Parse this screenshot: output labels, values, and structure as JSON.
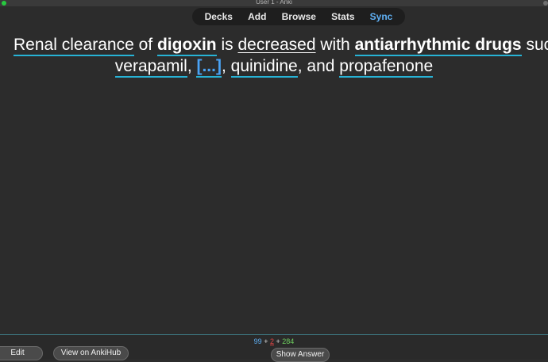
{
  "window": {
    "title": "User 1 - Anki"
  },
  "toolbar": {
    "items": [
      {
        "label": "Decks"
      },
      {
        "label": "Add"
      },
      {
        "label": "Browse"
      },
      {
        "label": "Stats"
      },
      {
        "label": "Sync",
        "active_color": "#5fb0f5"
      }
    ]
  },
  "card": {
    "line1": [
      {
        "text": "Renal clearance",
        "style": "highlight"
      },
      {
        "text": " of "
      },
      {
        "text": "digoxin",
        "style": "bold-highlight"
      },
      {
        "text": " is "
      },
      {
        "text": "decreased",
        "style": "underline"
      },
      {
        "text": " with "
      },
      {
        "text": "antiarrhythmic drugs",
        "style": "bold-highlight"
      },
      {
        "text": " such"
      }
    ],
    "line2": [
      {
        "text": "verapamil",
        "style": "highlight"
      },
      {
        "text": ", "
      },
      {
        "text": "[...]",
        "style": "cloze"
      },
      {
        "text": ", "
      },
      {
        "text": "quinidine",
        "style": "highlight"
      },
      {
        "text": ", and "
      },
      {
        "text": "propafenone",
        "style": "highlight"
      }
    ],
    "highlight_color": "#27b3d6",
    "cloze_color": "#4aa3f5"
  },
  "bottom": {
    "edit_label": "Edit",
    "ankihub_label": "View on AnkiHub",
    "show_answer_label": "Show Answer",
    "counts": {
      "new": "99",
      "learn": "2",
      "review": "284",
      "sep": "+"
    },
    "colors": {
      "new": "#5fb0f5",
      "learn": "#e04646",
      "review": "#6fcf5f"
    }
  }
}
